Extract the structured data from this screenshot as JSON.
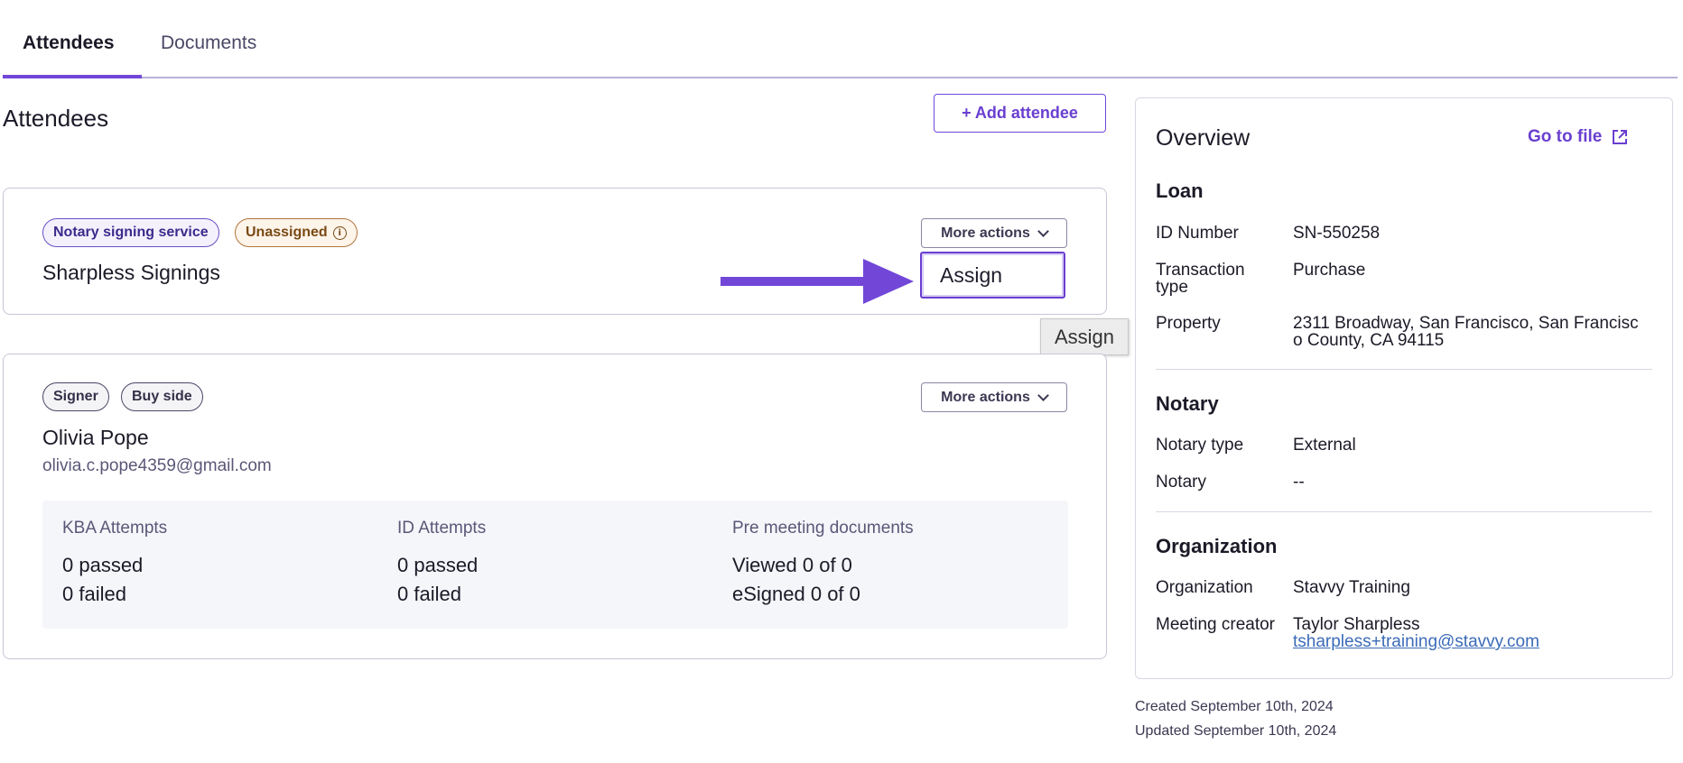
{
  "tabs": {
    "attendees": "Attendees",
    "documents": "Documents"
  },
  "section_title": "Attendees",
  "add_attendee_label": "+ Add attendee",
  "cards": {
    "service": {
      "badges": {
        "role": "Notary signing service",
        "status": "Unassigned"
      },
      "name": "Sharpless Signings",
      "more_actions": "More actions",
      "dropdown_item": "Assign"
    },
    "signer": {
      "badges": {
        "role": "Signer",
        "side": "Buy side"
      },
      "name": "Olivia Pope",
      "email": "olivia.c.pope4359@gmail.com",
      "more_actions": "More actions",
      "stats": {
        "kba": {
          "title": "KBA Attempts",
          "line1": "0 passed",
          "line2": "0 failed"
        },
        "id": {
          "title": "ID Attempts",
          "line1": "0 passed",
          "line2": "0 failed"
        },
        "docs": {
          "title": "Pre meeting documents",
          "line1": "Viewed 0 of 0",
          "line2": "eSigned 0 of 0"
        }
      }
    }
  },
  "tooltip": "Assign",
  "overview": {
    "title": "Overview",
    "go_to_file": "Go to file",
    "loan": {
      "heading": "Loan",
      "id_label": "ID Number",
      "id_value": "SN-550258",
      "txn_label_1": "Transaction",
      "txn_label_2": "type",
      "txn_value": "Purchase",
      "property_label": "Property",
      "property_value_1": "2311 Broadway, San Francisco, San Francisc",
      "property_value_2": "o County, CA 94115"
    },
    "notary": {
      "heading": "Notary",
      "type_label": "Notary type",
      "type_value": "External",
      "notary_label": "Notary",
      "notary_value": "--"
    },
    "organization": {
      "heading": "Organization",
      "org_label": "Organization",
      "org_value": "Stavvy Training",
      "creator_label": "Meeting creator",
      "creator_name": "Taylor Sharpless",
      "creator_email": "tsharpless+training@stavvy.com"
    }
  },
  "meta": {
    "created": "Created September 10th, 2024",
    "updated": "Updated September 10th, 2024"
  },
  "colors": {
    "accent": "#7247d8",
    "link": "#3b6bb8"
  },
  "icons": {
    "info": "info-circle-icon",
    "external": "external-link-icon",
    "chevron": "chevron-down-icon",
    "arrow": "arrow-right-icon"
  }
}
